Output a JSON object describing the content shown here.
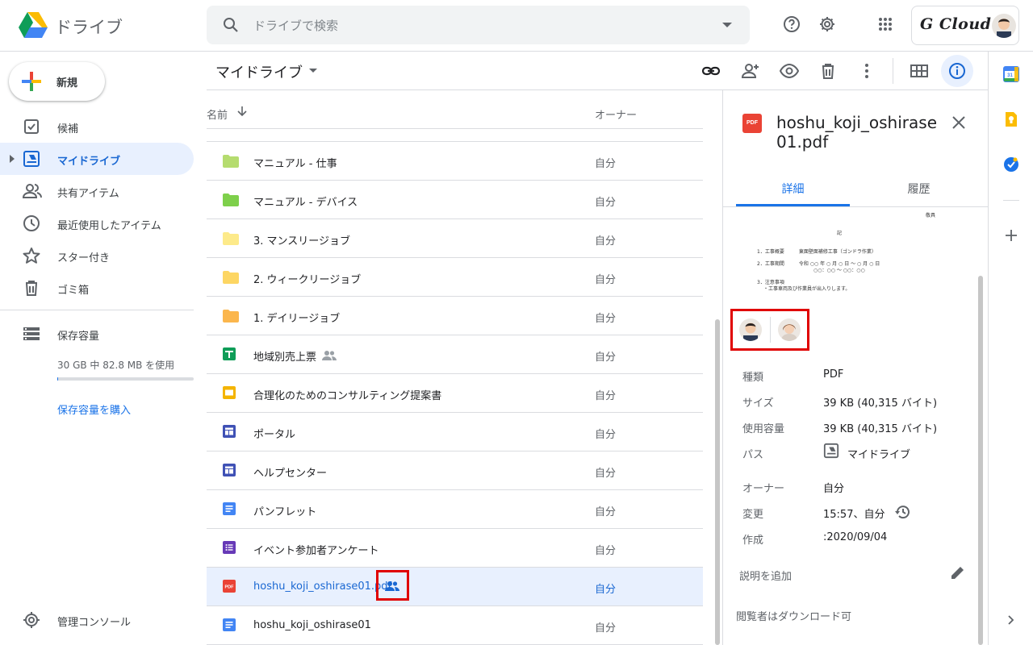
{
  "header": {
    "app_name": "ドライブ",
    "search_placeholder": "ドライブで検索",
    "account_brand": "G Cloud"
  },
  "sidebar": {
    "new_label": "新規",
    "items": [
      {
        "label": "候補",
        "icon": "checkbox-icon"
      },
      {
        "label": "マイドライブ",
        "icon": "my-drive-icon",
        "active": true
      },
      {
        "label": "共有アイテム",
        "icon": "people-icon"
      },
      {
        "label": "最近使用したアイテム",
        "icon": "clock-icon"
      },
      {
        "label": "スター付き",
        "icon": "star-icon"
      },
      {
        "label": "ゴミ箱",
        "icon": "trash-icon"
      }
    ],
    "storage_label": "保存容量",
    "storage_used": "30 GB 中 82.8 MB を使用",
    "storage_fraction": 0.003,
    "buy_storage": "保存容量を購入",
    "admin_console": "管理コンソール"
  },
  "toolbar": {
    "title": "マイドライブ"
  },
  "list": {
    "col_name": "名前",
    "col_owner": "オーナー",
    "rows": [
      {
        "name": "マニュアル - 仕事",
        "owner": "自分",
        "type": "folder",
        "color": "#b5dc6f"
      },
      {
        "name": "マニュアル - デバイス",
        "owner": "自分",
        "type": "folder",
        "color": "#7ed04b"
      },
      {
        "name": "3. マンスリージョブ",
        "owner": "自分",
        "type": "folder",
        "color": "#fdea8a"
      },
      {
        "name": "2. ウィークリージョブ",
        "owner": "自分",
        "type": "folder",
        "color": "#fdd663"
      },
      {
        "name": "1. デイリージョブ",
        "owner": "自分",
        "type": "folder",
        "color": "#fbb64d"
      },
      {
        "name": "地域別売上票",
        "owner": "自分",
        "type": "sheets",
        "shared": true
      },
      {
        "name": "合理化のためのコンサルティング提案書",
        "owner": "自分",
        "type": "slides"
      },
      {
        "name": "ポータル",
        "owner": "自分",
        "type": "sites"
      },
      {
        "name": "ヘルプセンター",
        "owner": "自分",
        "type": "sites"
      },
      {
        "name": "パンフレット",
        "owner": "自分",
        "type": "docs"
      },
      {
        "name": "イベント参加者アンケート",
        "owner": "自分",
        "type": "forms"
      },
      {
        "name": "hoshu_koji_oshirase01.pdf",
        "owner": "自分",
        "type": "pdf",
        "shared": true,
        "selected": true
      },
      {
        "name": "hoshu_koji_oshirase01",
        "owner": "自分",
        "type": "docs"
      }
    ]
  },
  "details": {
    "file_badge": "PDF",
    "title": "hoshu_koji_oshirase01.pdf",
    "tab_details": "詳細",
    "tab_history": "履歴",
    "preview": {
      "line_top": "敬具",
      "line_center": "記",
      "line_1": "1．工事概要　　　東面壁面補修工事（ゴンドラ作業）",
      "line_2": "2．工事期間　　　令和 ○○ 年 ○ 月 ○ 日 ～ ○ 月 ○ 日",
      "line_3": "○○：○○ ～ ○○：○○",
      "line_4": "3．注意事項",
      "line_5": "・工事車両及び作業員が出入りします。"
    },
    "fields": [
      {
        "label": "種類",
        "value": "PDF"
      },
      {
        "label": "サイズ",
        "value": "39 KB (40,315 バイト)"
      },
      {
        "label": "使用容量",
        "value": "39 KB (40,315 バイト)"
      },
      {
        "label": "パス",
        "value": "マイドライブ"
      },
      {
        "label": "オーナー",
        "value": "自分"
      },
      {
        "label": "変更",
        "value": "15:57、自分"
      },
      {
        "label": "作成",
        "value": ":2020/09/04"
      }
    ],
    "add_description": "説明を追加",
    "viewers_download": "閲覧者はダウンロード可"
  },
  "colors": {
    "accent": "#1a73e8",
    "selected_bg": "#e8f0fe",
    "highlight_red": "#e00000",
    "pdf_red": "#ea4335"
  }
}
